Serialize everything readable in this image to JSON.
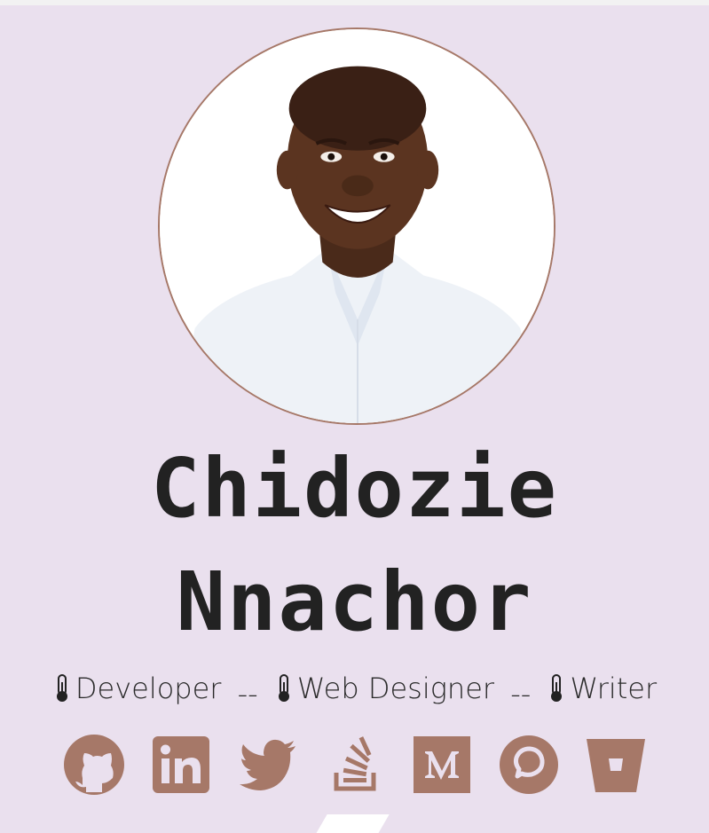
{
  "profile": {
    "first_name": "Chidozie",
    "last_name": "Nnachor",
    "roles": [
      {
        "icon": "thermometer-icon",
        "label": "Developer"
      },
      {
        "icon": "thermometer-icon",
        "label": "Web Designer"
      },
      {
        "icon": "thermometer-icon",
        "label": "Writer"
      }
    ],
    "separator": "--"
  },
  "socials": [
    {
      "name": "github-icon"
    },
    {
      "name": "linkedin-icon"
    },
    {
      "name": "twitter-icon"
    },
    {
      "name": "stackoverflow-icon"
    },
    {
      "name": "medium-icon"
    },
    {
      "name": "chat-bubble-icon"
    },
    {
      "name": "bucket-icon"
    }
  ],
  "colors": {
    "background": "#eae0ee",
    "accent": "#a67868",
    "text": "#222222"
  }
}
